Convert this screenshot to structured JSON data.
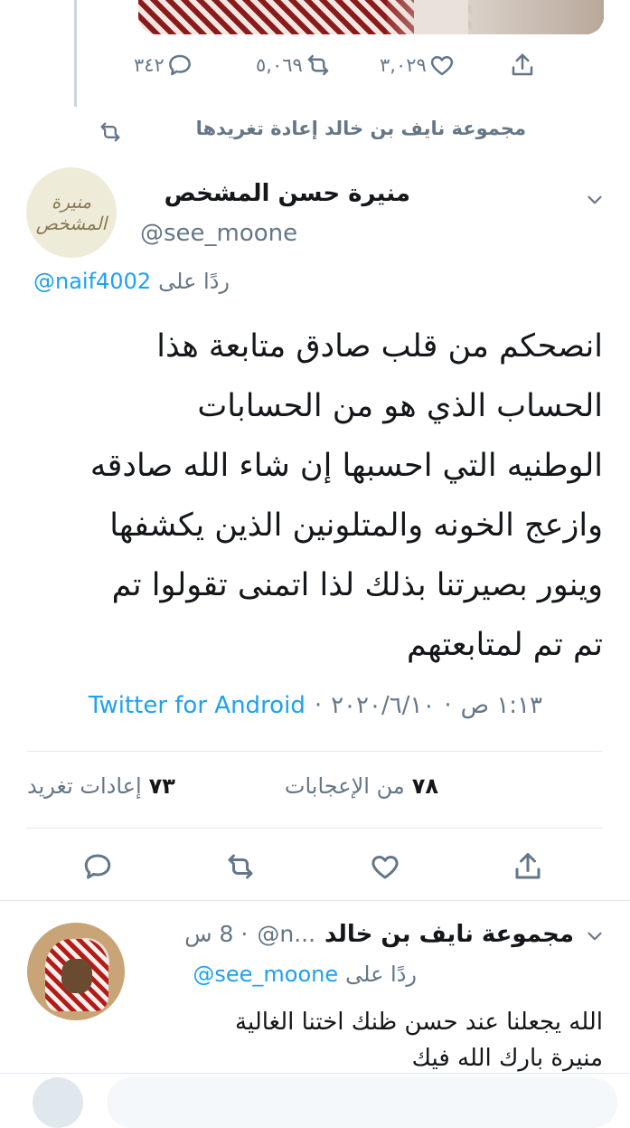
{
  "prev_tweet": {
    "actions": {
      "replies": "٣٤٢",
      "retweets": "٥,٠٦٩",
      "likes": "٣,٠٢٩"
    }
  },
  "retweet_context": {
    "text": "مجموعة نايف بن خالد إعادة تغريدها"
  },
  "main_tweet": {
    "author": {
      "name": "منيرة حسن المشخص",
      "handle": "@see_moone",
      "avatar_text": [
        "منيرة",
        "المشخص"
      ]
    },
    "reply_to": {
      "prefix": "ردًا على",
      "handle": "@naif4002"
    },
    "body_lines": [
      "انصحكم من قلب صادق متابعة  هذا",
      "الحساب الذي هو من الحسابات",
      "الوطنيه التي احسبها إن شاء الله صادقه",
      "وازعج الخونه والمتلونين الذين يكشفها",
      "وينور بصيرتنا بذلك لذا اتمنى تقولوا تم",
      "تم تم لمتابعتهم"
    ],
    "meta": {
      "time": "١:١٣ ص",
      "sep1": "·",
      "date": "٢٠٢٠/٦/١٠",
      "sep2": "·",
      "source": "Twitter for Android"
    },
    "stats": {
      "likes_count": "٧٨",
      "likes_label": "من الإعجابات",
      "retweets_count": "٧٣",
      "retweets_label": "إعادات تغريد"
    }
  },
  "reply_tweet": {
    "author": {
      "name": "مجموعة نايف بن خالد",
      "handle": "@n...",
      "time": "· 8 س"
    },
    "reply_to": {
      "prefix": "ردًا على",
      "handle": "@see_moone"
    },
    "body_lines": [
      "الله يجعلنا عند حسن ظنك اختنا الغالية",
      "منيرة بارك الله فيك"
    ]
  },
  "colors": {
    "link": "#1da1f2",
    "secondary": "#657786",
    "divider": "#e1e8ed"
  }
}
